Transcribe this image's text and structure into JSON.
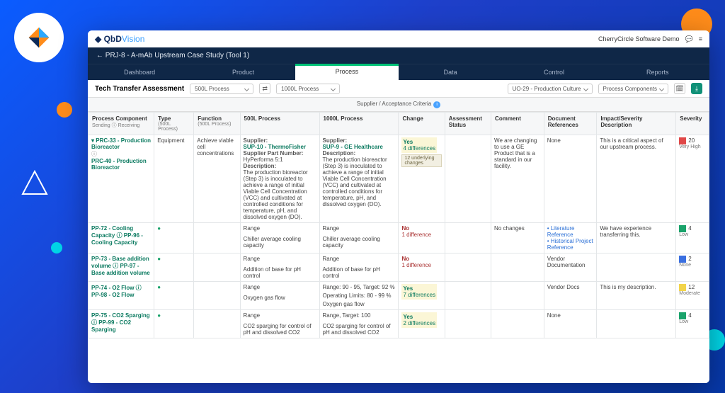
{
  "brand": {
    "name": "QbD",
    "suffix": "Vision"
  },
  "top_right": {
    "org": "CherryCircle Software Demo"
  },
  "breadcrumb": "← PRJ-8 - A-mAb Upstream Case Study (Tool 1)",
  "tabs": [
    "Dashboard",
    "Product",
    "Process",
    "Data",
    "Control",
    "Reports"
  ],
  "active_tab": 2,
  "filter": {
    "title": "Tech Transfer Assessment",
    "process_a": "500L Process",
    "process_b": "1000L Process",
    "uo": "UO-29 - Production Culture",
    "scope": "Process Components"
  },
  "criteria_header": "Supplier / Acceptance Criteria",
  "columns": {
    "comp": "Process Component",
    "comp_sub": "Sending ⓘ Receiving",
    "type": "Type",
    "type_sub": "(500L Process)",
    "func": "Function",
    "func_sub": "(500L Process)",
    "p500": "500L Process",
    "p1000": "1000L Process",
    "change": "Change",
    "assess": "Assessment Status",
    "comment": "Comment",
    "docref": "Document References",
    "impact": "Impact/Severity Description",
    "sev": "Severity"
  },
  "rows": [
    {
      "comp_a": "PRC-33 - Production Bioreactor",
      "comp_link_icon": "ⓘ",
      "comp_b": "PRC-40 - Production Bioreactor",
      "type": "Equipment",
      "func": "Achieve viable cell concentrations",
      "p500": {
        "supplier_lbl": "Supplier:",
        "supplier": "SUP-10 - ThermoFisher",
        "pn_lbl": "Supplier Part Number:",
        "pn": "HyPerforma 5:1",
        "desc_lbl": "Description:",
        "desc": "The production bioreactor (Step 3) is inoculated to achieve a range of initial Viable Cell Concentration (VCC) and cultivated at controlled conditions for temperature, pH, and dissolved oxygen (DO)."
      },
      "p1000": {
        "supplier_lbl": "Supplier:",
        "supplier": "SUP-9 - GE Healthcare",
        "desc_lbl": "Description:",
        "desc": "The production bioreactor (Step 3) is inoculated to achieve a range of initial Viable Cell Concentration (VCC) and cultivated at controlled conditions for temperature, pH, and dissolved oxygen (DO)."
      },
      "change": {
        "val": "Yes",
        "diff": "4 differences",
        "under": "12 underlying changes"
      },
      "comment": "We are changing to use a GE Product that is a standard in our facility.",
      "docref": "None",
      "impact": "This is a critical aspect of our upstream process.",
      "sev": {
        "color": "#e04848",
        "num": "20",
        "label": "Very High"
      }
    },
    {
      "comp_a": "PP-72 - Cooling Capacity ⓘ PP-96 - Cooling Capacity",
      "p500_head": "Range",
      "p500_body": "Chiller average cooling capacity",
      "p1000_head": "Range",
      "p1000_body": "Chiller average cooling capacity",
      "change": {
        "val": "No",
        "diff": "1 difference"
      },
      "comment": "No changes",
      "docref_links": [
        "• Literature Reference",
        "• Historical Project Reference"
      ],
      "impact": "We have experience transferring this.",
      "sev": {
        "color": "#1aa36b",
        "num": "4",
        "label": "Low"
      }
    },
    {
      "comp_a": "PP-73 - Base addition volume ⓘ PP-97 - Base addition volume",
      "p500_head": "Range",
      "p500_body": "Addition of base for pH control",
      "p1000_head": "Range",
      "p1000_body": "Addition of base for pH control",
      "change": {
        "val": "No",
        "diff": "1 difference"
      },
      "docref": "Vendor Documentation",
      "sev": {
        "color": "#3a6fe0",
        "num": "2",
        "label": "None"
      }
    },
    {
      "comp_a": "PP-74 - O2 Flow ⓘ PP-98 - O2 Flow",
      "p500_head": "Range",
      "p500_body": "Oxygen gas flow",
      "p1000_head": "Range: 90 - 95, Target: 92 %",
      "p1000_mid": "Operating Limits: 80 - 99 %",
      "p1000_body": "Oxygen gas flow",
      "change": {
        "val": "Yes",
        "diff": "7 differences"
      },
      "docref": "Vendor Docs",
      "impact": "This is my description.",
      "sev": {
        "color": "#f2d44b",
        "num": "12",
        "label": "Moderate"
      }
    },
    {
      "comp_a": "PP-75 - CO2 Sparging ⓘ PP-99 - CO2 Sparging",
      "p500_head": "Range",
      "p500_body": "CO2 sparging for control of pH and dissolved CO2",
      "p1000_head": "Range, Target: 100",
      "p1000_body": "CO2 sparging for control of pH and dissolved CO2",
      "change": {
        "val": "Yes",
        "diff": "2 differences"
      },
      "docref": "None",
      "sev": {
        "color": "#1aa36b",
        "num": "4",
        "label": "Low"
      }
    }
  ]
}
